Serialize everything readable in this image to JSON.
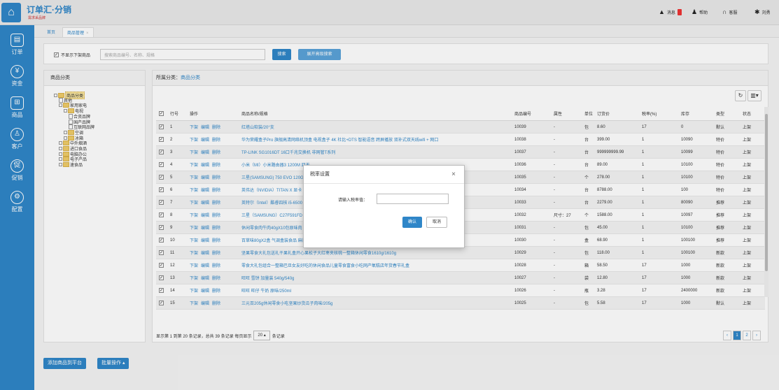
{
  "header": {
    "logo_glyph": "⌂",
    "brand_title": "订单汇·分销",
    "brand_subtitle": "需求采品牌",
    "messages_label": "消息",
    "help_label": "帮助",
    "support_label": "客服",
    "user_label": "刘勇"
  },
  "sidebar": {
    "items": [
      {
        "label": "订单",
        "icon": "order-icon",
        "glyph": "▤"
      },
      {
        "label": "资金",
        "icon": "funds-icon",
        "glyph": "¥"
      },
      {
        "label": "商品",
        "icon": "goods-icon",
        "glyph": "⊞"
      },
      {
        "label": "客户",
        "icon": "customer-icon",
        "glyph": "♙"
      },
      {
        "label": "促销",
        "icon": "promo-icon",
        "glyph": "促"
      },
      {
        "label": "配置",
        "icon": "config-icon",
        "glyph": "⚙"
      }
    ]
  },
  "tabs": {
    "home": "首页",
    "current": "商品管理",
    "close": "×"
  },
  "filter": {
    "hide_off_label": "不显示下架商品",
    "hide_off_checked": true,
    "search_placeholder": "搜索商品编号、名称、规格",
    "search_button": "搜索",
    "advanced_button": "展开高级搜索"
  },
  "category_panel": {
    "title": "商品分类",
    "tree": [
      {
        "label": "商品分类",
        "level": 0,
        "type": "folder",
        "expander": "⊟",
        "selected": true
      },
      {
        "label": "其他",
        "level": 1,
        "type": "doc"
      },
      {
        "label": "家用家电",
        "level": 1,
        "type": "folder",
        "expander": "⊟"
      },
      {
        "label": "电视",
        "level": 2,
        "type": "folder",
        "expander": "⊟"
      },
      {
        "label": "合资品牌",
        "level": 3,
        "type": "doc"
      },
      {
        "label": "国产品牌",
        "level": 3,
        "type": "doc"
      },
      {
        "label": "互联网品牌",
        "level": 3,
        "type": "doc"
      },
      {
        "label": "空调",
        "level": 2,
        "type": "folder",
        "expander": "⊞"
      },
      {
        "label": "冰箱",
        "level": 2,
        "type": "folder",
        "expander": "⊞"
      },
      {
        "label": "中外烟酒",
        "level": 1,
        "type": "folder",
        "expander": "⊞"
      },
      {
        "label": "进口食品",
        "level": 1,
        "type": "folder",
        "expander": "⊞"
      },
      {
        "label": "电脑办公",
        "level": 1,
        "type": "folder",
        "expander": "⊞"
      },
      {
        "label": "电子产品",
        "level": 1,
        "type": "folder",
        "expander": "⊞"
      },
      {
        "label": "速食品",
        "level": 1,
        "type": "folder",
        "expander": "⊞"
      }
    ]
  },
  "product_panel": {
    "path_label": "所属分类：",
    "path_link": "商品分类",
    "refresh_glyph": "↻",
    "columns_glyph": "▥▾",
    "columns": [
      "行号",
      "操作",
      "商品名称/规格",
      "商品编号",
      "属性",
      "单位",
      "订货价",
      "税率(%)",
      "库存",
      "类型",
      "状态"
    ],
    "actions": [
      "下架",
      "编辑",
      "删除"
    ],
    "rows": [
      {
        "no": "1",
        "name": "红塔山软装/20°支",
        "code": "10039",
        "attr": "-",
        "unit": "包",
        "price": "8.60",
        "tax": "17",
        "stock": "0",
        "type": "默认",
        "status": "上架"
      },
      {
        "no": "2",
        "name": "华为荣耀盒子Pro 旗舰高清网络机顶盒 电视盒子 4K 杜比+DTS 智能语音 跨屏播放 双补式双天线wifi + 网口",
        "code": "10038",
        "attr": "-",
        "unit": "台",
        "price": "399.00",
        "tax": "1",
        "stock": "10090",
        "type": "特价",
        "status": "上架"
      },
      {
        "no": "3",
        "name": "TP-LINK SG1016DT 16口千兆交换机 非网管T系列",
        "code": "10037",
        "attr": "-",
        "unit": "台",
        "price": "999999999.99",
        "tax": "1",
        "stock": "10099",
        "type": "特价",
        "status": "上架"
      },
      {
        "no": "4",
        "name": "小米（MI）小米路由器3 1200M 四天",
        "code": "10036",
        "attr": "-",
        "unit": "台",
        "price": "89.00",
        "tax": "1",
        "stock": "10100",
        "type": "特价",
        "status": "上架"
      },
      {
        "no": "5",
        "name": "三星(SAMSUNG) 750 EVO 120G SA",
        "code": "10035",
        "attr": "-",
        "unit": "个",
        "price": "278.00",
        "tax": "1",
        "stock": "10100",
        "type": "特价",
        "status": "上架"
      },
      {
        "no": "6",
        "name": "英伟达（NVIDIA）TITAN X 显卡",
        "code": "10034",
        "attr": "-",
        "unit": "台",
        "price": "8788.00",
        "tax": "1",
        "stock": "100",
        "type": "特价",
        "status": "上架"
      },
      {
        "no": "7",
        "name": "英特尔（Intel）酷睿四核 i5-6500 11",
        "code": "10033",
        "attr": "-",
        "unit": "台",
        "price": "2279.00",
        "tax": "1",
        "stock": "80090",
        "type": "推荐",
        "status": "上架"
      },
      {
        "no": "8",
        "name": "三星（SAMSUNG）C27F591FD 27寸",
        "code": "10032",
        "attr": "尺寸：27",
        "unit": "个",
        "price": "1588.00",
        "tax": "1",
        "stock": "10097",
        "type": "推荐",
        "status": "上架"
      },
      {
        "no": "9",
        "name": "休闲零食肉牛肉40gX10包原味肉",
        "code": "10031",
        "attr": "-",
        "unit": "包",
        "price": "45.00",
        "tax": "1",
        "stock": "10100",
        "type": "推荐",
        "status": "上架"
      },
      {
        "no": "10",
        "name": "百草味80gX2盒 气调盒装食品 麻辣休闲零食刷表小包/80g",
        "code": "10030",
        "attr": "-",
        "unit": "盒",
        "price": "68.90",
        "tax": "1",
        "stock": "100100",
        "type": "推荐",
        "status": "上架"
      },
      {
        "no": "11",
        "name": "坚果零食大礼包送礼干果礼盒开心果松子大红枣夹核桃一整箱休闲零食1610g/1610g",
        "code": "10029",
        "attr": "-",
        "unit": "包",
        "price": "118.00",
        "tax": "1",
        "stock": "100100",
        "type": "新款",
        "status": "上架"
      },
      {
        "no": "12",
        "name": "零食大礼包组合一整箱巴旦女友好吃的休闲食品儿童零食富食小吃网产氧糕店年货春节礼盒",
        "code": "10028",
        "attr": "-",
        "unit": "箱",
        "price": "58.50",
        "tax": "17",
        "stock": "1000",
        "type": "新款",
        "status": "上架"
      },
      {
        "no": "13",
        "name": "旺旺 雪饼 加量装 540g/540g",
        "code": "10027",
        "attr": "-",
        "unit": "袋",
        "price": "12.80",
        "tax": "17",
        "stock": "1000",
        "type": "新款",
        "status": "上架"
      },
      {
        "no": "14",
        "name": "旺旺 旺仔 牛奶 原味/250ml",
        "code": "10026",
        "attr": "-",
        "unit": "瓶",
        "price": "3.28",
        "tax": "17",
        "stock": "2400000",
        "type": "新款",
        "status": "上架"
      },
      {
        "no": "15",
        "name": "三元百205g休闲零食小吃坚果炒货瓜子肉味/205g",
        "code": "10025",
        "attr": "-",
        "unit": "包",
        "price": "5.58",
        "tax": "17",
        "stock": "1000",
        "type": "默认",
        "status": "上架"
      }
    ],
    "footer_text": "显示第 1 到第 20 条记录，总共 39 条记录 每页显示",
    "page_size": "20 ▴",
    "footer_suffix": "条记录",
    "pages": [
      "‹",
      "1",
      "2",
      "›"
    ],
    "current_page": "1"
  },
  "modal": {
    "title": "税率设置",
    "close": "×",
    "label": "请输入税率值：",
    "ok": "确认",
    "cancel": "取消"
  },
  "bottom": {
    "add_button": "添加商品到平台",
    "batch_button": "批量操作 ▴"
  }
}
